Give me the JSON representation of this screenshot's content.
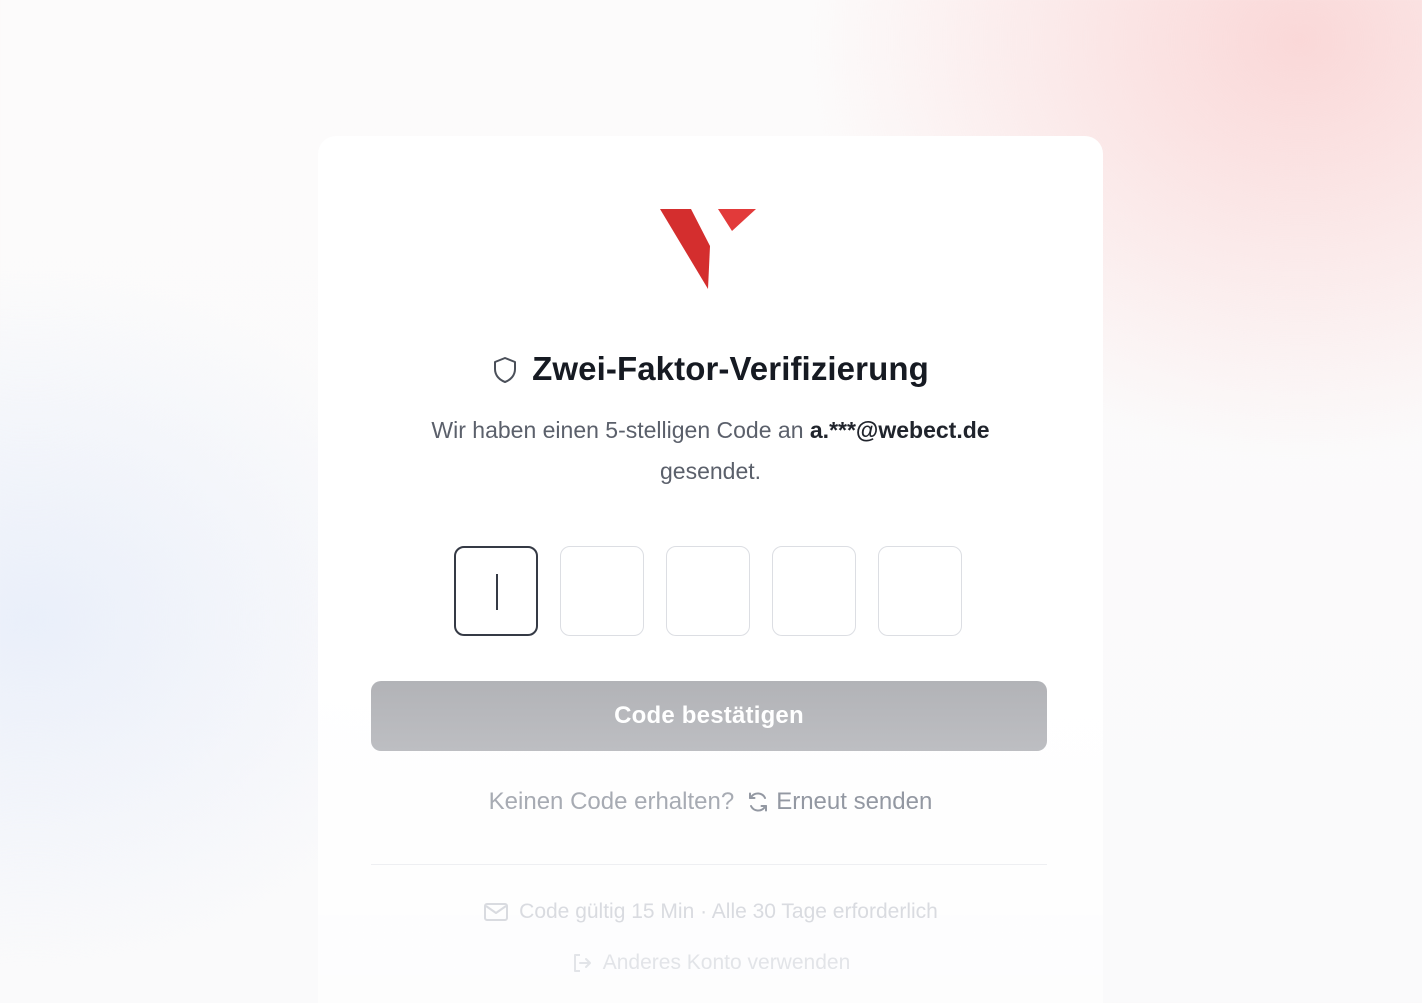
{
  "brand": {
    "logo_color_primary": "#d63030",
    "logo_color_secondary": "#e33b3b"
  },
  "header": {
    "title": "Zwei-Faktor-Verifizierung",
    "title_icon": "shield-icon"
  },
  "message": {
    "prefix": "Wir haben einen 5-stelligen Code an ",
    "email": "a.***@webect.de",
    "suffix": " gesendet."
  },
  "otp": {
    "length": 5,
    "digits": [
      "",
      "",
      "",
      "",
      ""
    ],
    "active_index": 0
  },
  "actions": {
    "confirm_label": "Code bestätigen",
    "confirm_enabled": false,
    "resend_question": "Keinen Code erhalten?",
    "resend_label": "Erneut senden",
    "resend_icon": "refresh-icon"
  },
  "footer": {
    "validity_text": "Code gültig 15 Min · Alle 30 Tage erforderlich",
    "validity_icon": "mail-icon",
    "switch_account_label": "Anderes Konto verwenden",
    "switch_account_icon": "logout-icon"
  }
}
